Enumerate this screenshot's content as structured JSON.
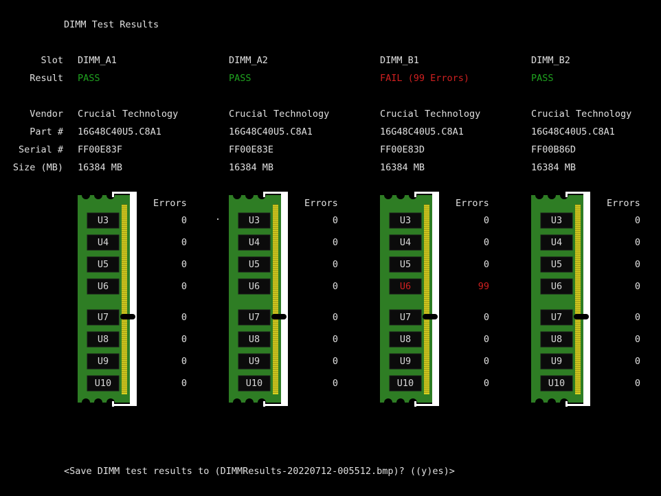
{
  "title": "DIMM Test Results",
  "labels": {
    "slot": "Slot",
    "result": "Result",
    "vendor": "Vendor",
    "part": "Part #",
    "serial": "Serial #",
    "size": "Size (MB)"
  },
  "errors_header": "Errors",
  "dimms": [
    {
      "slot": "DIMM_A1",
      "result": "PASS",
      "status": "pass",
      "vendor": "Crucial Technology",
      "part": "16G48C40U5.C8A1",
      "serial": "FF00E83F",
      "size": "16384 MB",
      "chips": [
        {
          "name": "U3",
          "errors": "0"
        },
        {
          "name": "U4",
          "errors": "0"
        },
        {
          "name": "U5",
          "errors": "0"
        },
        {
          "name": "U6",
          "errors": "0"
        },
        {
          "name": "U7",
          "errors": "0"
        },
        {
          "name": "U8",
          "errors": "0"
        },
        {
          "name": "U9",
          "errors": "0"
        },
        {
          "name": "U10",
          "errors": "0"
        }
      ]
    },
    {
      "slot": "DIMM_A2",
      "result": "PASS",
      "status": "pass",
      "vendor": "Crucial Technology",
      "part": "16G48C40U5.C8A1",
      "serial": "FF00E83E",
      "size": "16384 MB",
      "chips": [
        {
          "name": "U3",
          "errors": "0"
        },
        {
          "name": "U4",
          "errors": "0"
        },
        {
          "name": "U5",
          "errors": "0"
        },
        {
          "name": "U6",
          "errors": "0"
        },
        {
          "name": "U7",
          "errors": "0"
        },
        {
          "name": "U8",
          "errors": "0"
        },
        {
          "name": "U9",
          "errors": "0"
        },
        {
          "name": "U10",
          "errors": "0"
        }
      ]
    },
    {
      "slot": "DIMM_B1",
      "result": "FAIL (99 Errors)",
      "status": "fail",
      "vendor": "Crucial Technology",
      "part": "16G48C40U5.C8A1",
      "serial": "FF00E83D",
      "size": "16384 MB",
      "chips": [
        {
          "name": "U3",
          "errors": "0"
        },
        {
          "name": "U4",
          "errors": "0"
        },
        {
          "name": "U5",
          "errors": "0"
        },
        {
          "name": "U6",
          "errors": "99",
          "failed": true
        },
        {
          "name": "U7",
          "errors": "0"
        },
        {
          "name": "U8",
          "errors": "0"
        },
        {
          "name": "U9",
          "errors": "0"
        },
        {
          "name": "U10",
          "errors": "0"
        }
      ]
    },
    {
      "slot": "DIMM_B2",
      "result": "PASS",
      "status": "pass",
      "vendor": "Crucial Technology",
      "part": "16G48C40U5.C8A1",
      "serial": "FF00B86D",
      "size": "16384 MB",
      "chips": [
        {
          "name": "U3",
          "errors": "0"
        },
        {
          "name": "U4",
          "errors": "0"
        },
        {
          "name": "U5",
          "errors": "0"
        },
        {
          "name": "U6",
          "errors": "0"
        },
        {
          "name": "U7",
          "errors": "0"
        },
        {
          "name": "U8",
          "errors": "0"
        },
        {
          "name": "U9",
          "errors": "0"
        },
        {
          "name": "U10",
          "errors": "0"
        }
      ]
    }
  ],
  "prompt": "<Save DIMM test results to (DIMMResults-20220712-005512.bmp)? ((y)es)>",
  "colors": {
    "pass": "#1fa31f",
    "fail": "#d02020",
    "pcb": "#2e7d24",
    "contacts": "#d8d020"
  }
}
